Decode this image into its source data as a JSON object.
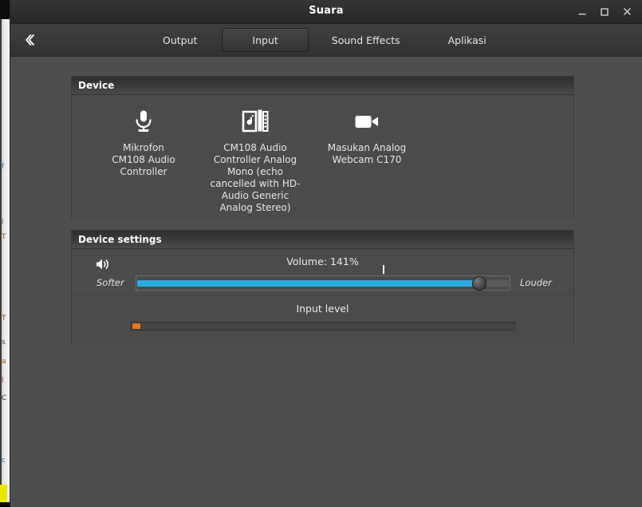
{
  "window": {
    "title": "Suara",
    "controls": {
      "minimize": "minimize",
      "maximize": "maximize",
      "close": "close"
    }
  },
  "headerbar": {
    "back_label": "«",
    "tabs": [
      {
        "label": "Output",
        "selected": false
      },
      {
        "label": "Input",
        "selected": true
      },
      {
        "label": "Sound Effects",
        "selected": false
      },
      {
        "label": "Aplikasi",
        "selected": false
      }
    ]
  },
  "device_panel": {
    "title": "Device",
    "devices": [
      {
        "icon": "microphone-icon",
        "label": "Mikrofon\nCM108 Audio\nController",
        "selected": false
      },
      {
        "icon": "audio-card-icon",
        "label": "CM108 Audio\nController Analog\nMono (echo\ncancelled with HD-\nAudio Generic\nAnalog Stereo)",
        "selected": false
      },
      {
        "icon": "webcam-icon",
        "label": "Masukan Analog\nWebcam C170",
        "selected": false
      }
    ]
  },
  "device_settings": {
    "title": "Device settings",
    "volume": {
      "icon": "speaker-volume-icon",
      "label": "Volume: 141%",
      "value_percent": 141,
      "min_label": "Softer",
      "max_label": "Louder",
      "slider_fill_percent": 92,
      "tick_percent": 66,
      "accent_color": "#2eaade"
    },
    "input_level": {
      "label": "Input level",
      "level_percent": 2,
      "level_color": "#e8781e"
    }
  },
  "background_window": {
    "accent_color": "#e8e800",
    "text_fragments": [
      "f",
      "l",
      "T",
      "T",
      "s",
      "a",
      "l",
      "C",
      "c"
    ]
  }
}
